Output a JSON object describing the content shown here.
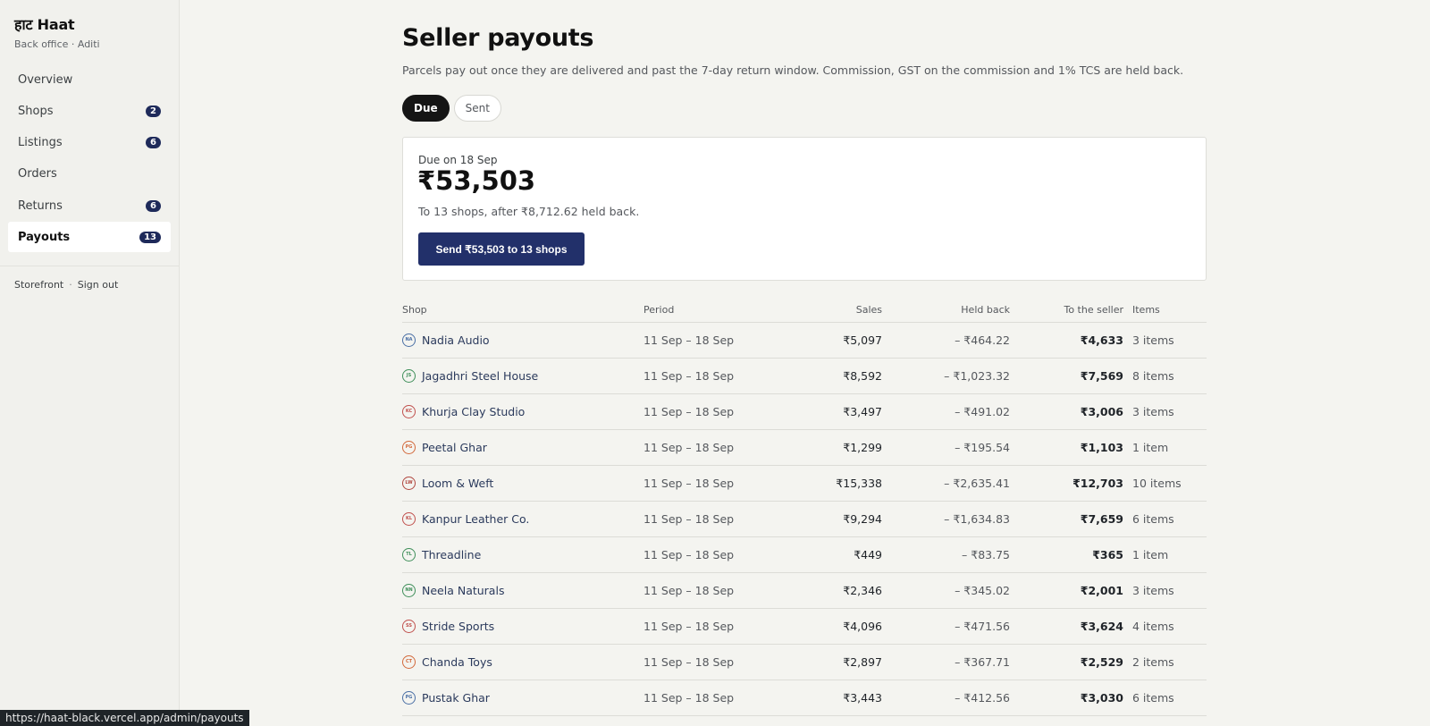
{
  "sidebar": {
    "brand": "हाट Haat",
    "subtitle": "Back office · Aditi",
    "items": [
      {
        "label": "Overview",
        "badge": null
      },
      {
        "label": "Shops",
        "badge": "2"
      },
      {
        "label": "Listings",
        "badge": "6"
      },
      {
        "label": "Orders",
        "badge": null
      },
      {
        "label": "Returns",
        "badge": "6"
      },
      {
        "label": "Payouts",
        "badge": "13"
      }
    ],
    "footer": {
      "storefront": "Storefront",
      "separator": "·",
      "signout": "Sign out"
    }
  },
  "page": {
    "title": "Seller payouts",
    "description": "Parcels pay out once they are delivered and past the 7-day return window. Commission, GST on the commission and 1% TCS are held back.",
    "tabs": [
      "Due",
      "Sent"
    ]
  },
  "due": {
    "label": "Due on 18 Sep",
    "amount": "₹53,503",
    "note": "To 13 shops, after ₹8,712.62 held back.",
    "button": "Send ₹53,503 to 13 shops"
  },
  "table": {
    "headers": {
      "shop": "Shop",
      "period": "Period",
      "sales": "Sales",
      "held": "Held back",
      "seller": "To the seller",
      "items": "Items"
    },
    "rows": [
      {
        "initials": "NA",
        "shop": "Nadia Audio",
        "period": "11 Sep – 18 Sep",
        "sales": "₹5,097",
        "held": "– ₹464.22",
        "seller": "₹4,633",
        "items": "3 items",
        "color": "#4a6fa5"
      },
      {
        "initials": "JS",
        "shop": "Jagadhri Steel House",
        "period": "11 Sep – 18 Sep",
        "sales": "₹8,592",
        "held": "– ₹1,023.32",
        "seller": "₹7,569",
        "items": "8 items",
        "color": "#3f8f5a"
      },
      {
        "initials": "KC",
        "shop": "Khurja Clay Studio",
        "period": "11 Sep – 18 Sep",
        "sales": "₹3,497",
        "held": "– ₹491.02",
        "seller": "₹3,006",
        "items": "3 items",
        "color": "#c0504d"
      },
      {
        "initials": "PG",
        "shop": "Peetal Ghar",
        "period": "11 Sep – 18 Sep",
        "sales": "₹1,299",
        "held": "– ₹195.54",
        "seller": "₹1,103",
        "items": "1 item",
        "color": "#d2693c"
      },
      {
        "initials": "LW",
        "shop": "Loom & Weft",
        "period": "11 Sep – 18 Sep",
        "sales": "₹15,338",
        "held": "– ₹2,635.41",
        "seller": "₹12,703",
        "items": "10 items",
        "color": "#b0473f"
      },
      {
        "initials": "KL",
        "shop": "Kanpur Leather Co.",
        "period": "11 Sep – 18 Sep",
        "sales": "₹9,294",
        "held": "– ₹1,634.83",
        "seller": "₹7,659",
        "items": "6 items",
        "color": "#c0504d"
      },
      {
        "initials": "TL",
        "shop": "Threadline",
        "period": "11 Sep – 18 Sep",
        "sales": "₹449",
        "held": "– ₹83.75",
        "seller": "₹365",
        "items": "1 item",
        "color": "#3f8f5a"
      },
      {
        "initials": "NN",
        "shop": "Neela Naturals",
        "period": "11 Sep – 18 Sep",
        "sales": "₹2,346",
        "held": "– ₹345.02",
        "seller": "₹2,001",
        "items": "3 items",
        "color": "#3f8f5a"
      },
      {
        "initials": "SS",
        "shop": "Stride Sports",
        "period": "11 Sep – 18 Sep",
        "sales": "₹4,096",
        "held": "– ₹471.56",
        "seller": "₹3,624",
        "items": "4 items",
        "color": "#c0504d"
      },
      {
        "initials": "CT",
        "shop": "Chanda Toys",
        "period": "11 Sep – 18 Sep",
        "sales": "₹2,897",
        "held": "– ₹367.71",
        "seller": "₹2,529",
        "items": "2 items",
        "color": "#d2693c"
      },
      {
        "initials": "PG",
        "shop": "Pustak Ghar",
        "period": "11 Sep – 18 Sep",
        "sales": "₹3,443",
        "held": "– ₹412.56",
        "seller": "₹3,030",
        "items": "6 items",
        "color": "#4a6fa5"
      }
    ]
  },
  "status_url": "https://haat-black.vercel.app/admin/payouts"
}
